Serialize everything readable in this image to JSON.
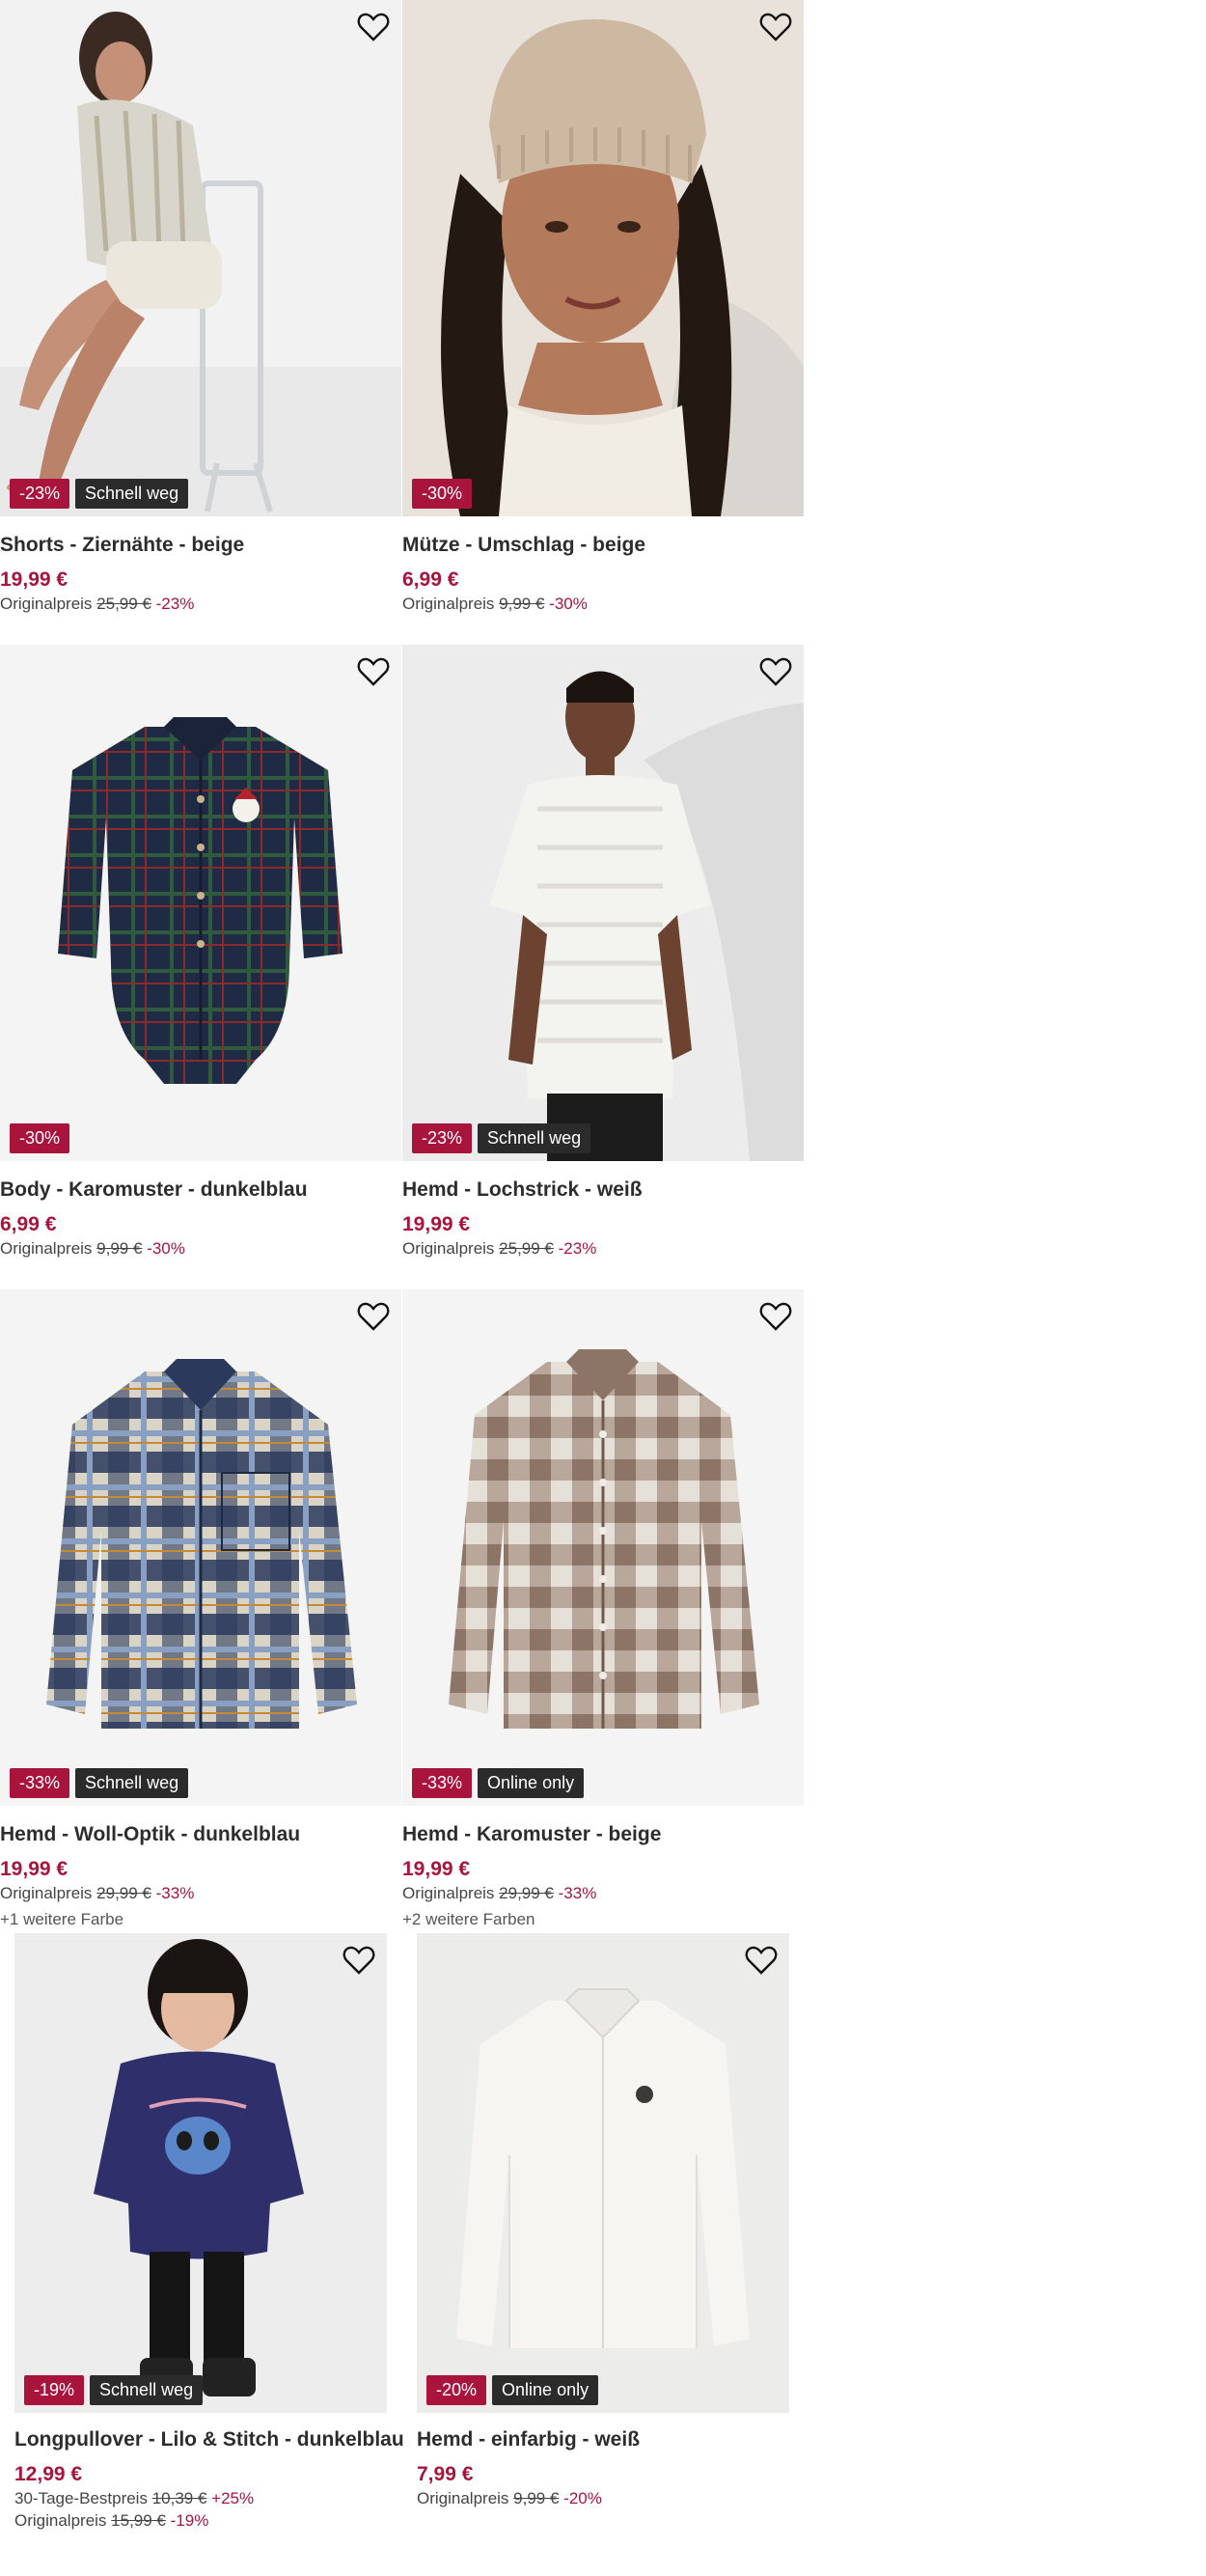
{
  "products": [
    {
      "title": "Shorts - Ziernähte - beige",
      "price": "19,99 €",
      "orig_label": "Originalpreis",
      "orig_price": "25,99 €",
      "orig_pct": "-23%",
      "badge_discount": "-23%",
      "badge_tag": "Schnell weg",
      "image": "woman-sitting-chair-icon"
    },
    {
      "title": "Mütze - Umschlag - beige",
      "price": "6,99 €",
      "orig_label": "Originalpreis",
      "orig_price": "9,99 €",
      "orig_pct": "-30%",
      "badge_discount": "-30%",
      "image": "woman-beanie-icon"
    },
    {
      "title": "Body - Karomuster - dunkelblau",
      "price": "6,99 €",
      "orig_label": "Originalpreis",
      "orig_price": "9,99 €",
      "orig_pct": "-30%",
      "badge_discount": "-30%",
      "image": "plaid-bodysuit-icon"
    },
    {
      "title": "Hemd - Lochstrick - weiß",
      "price": "19,99 €",
      "orig_label": "Originalpreis",
      "orig_price": "25,99 €",
      "orig_pct": "-23%",
      "badge_discount": "-23%",
      "badge_tag": "Schnell weg",
      "image": "man-white-shirt-icon"
    },
    {
      "title": "Hemd - Woll-Optik - dunkelblau",
      "price": "19,99 €",
      "orig_label": "Originalpreis",
      "orig_price": "29,99 €",
      "orig_pct": "-33%",
      "badge_discount": "-33%",
      "badge_tag": "Schnell weg",
      "more_colors": "+1 weitere Farbe",
      "image": "blue-plaid-shirt-icon"
    },
    {
      "title": "Hemd - Karomuster - beige",
      "price": "19,99 €",
      "orig_label": "Originalpreis",
      "orig_price": "29,99 €",
      "orig_pct": "-33%",
      "badge_discount": "-33%",
      "badge_tag": "Online only",
      "more_colors": "+2 weitere Farben",
      "image": "brown-check-shirt-icon"
    },
    {
      "title": "Longpullover - Lilo & Stitch - dunkelblau",
      "price": "12,99 €",
      "best_label": "30-Tage-Bestpreis",
      "best_price": "10,39 €",
      "best_pct": "+25%",
      "orig_label": "Originalpreis",
      "orig_price": "15,99 €",
      "orig_pct": "-19%",
      "badge_discount": "-19%",
      "badge_tag": "Schnell weg",
      "image": "girl-stitch-pullover-icon"
    },
    {
      "title": "Hemd - einfarbig - weiß",
      "price": "7,99 €",
      "orig_label": "Originalpreis",
      "orig_price": "9,99 €",
      "orig_pct": "-20%",
      "badge_discount": "-20%",
      "badge_tag": "Online only",
      "image": "white-shirt-icon"
    }
  ],
  "colors": {
    "accent": "#a8143c",
    "badge_dark": "#2b2b2b",
    "image_bg": "#f4f4f4"
  }
}
